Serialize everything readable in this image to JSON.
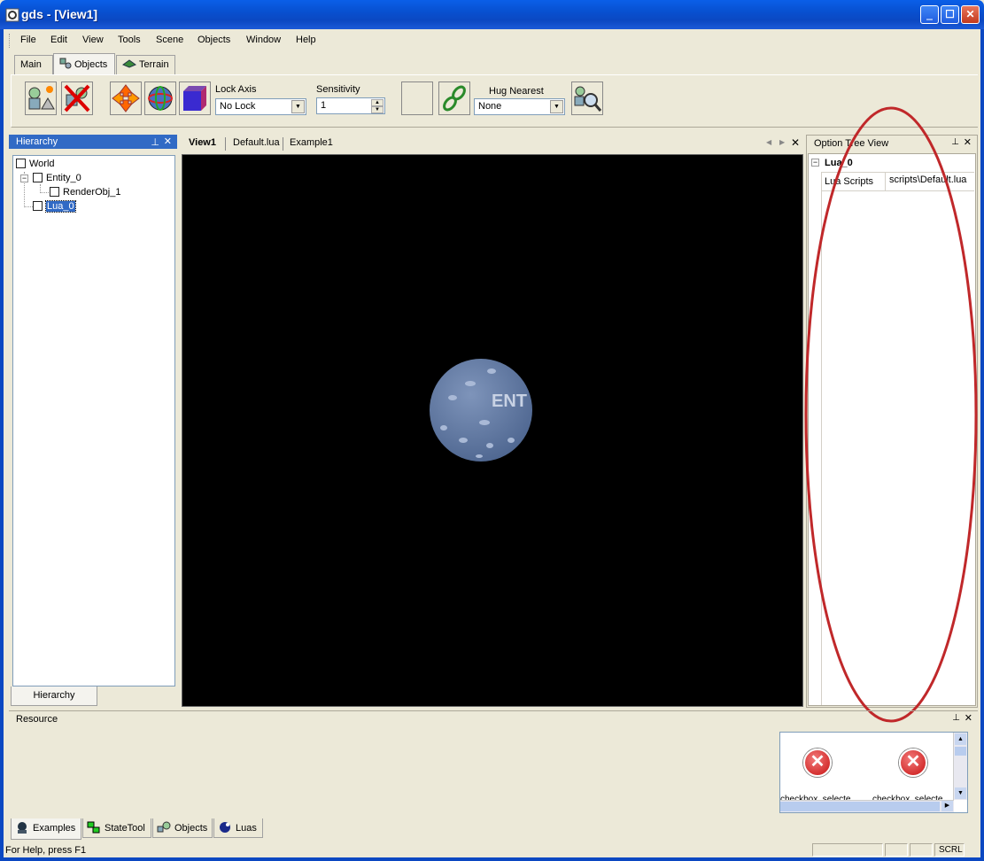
{
  "window": {
    "title": "gds - [View1]",
    "controls": {
      "minimize": "‗",
      "maximize": "☐",
      "close": "✕"
    }
  },
  "menu": [
    "File",
    "Edit",
    "View",
    "Tools",
    "Scene",
    "Objects",
    "Window",
    "Help"
  ],
  "toolbar_tabs": [
    "Main",
    "Objects",
    "Terrain"
  ],
  "toolbar": {
    "lock_axis_label": "Lock Axis",
    "lock_axis_value": "No Lock",
    "sensitivity_label": "Sensitivity",
    "sensitivity_value": "1",
    "hug_nearest_label": "Hug Nearest",
    "hug_nearest_value": "None"
  },
  "hierarchy": {
    "title": "Hierarchy",
    "nodes": [
      "World",
      "Entity_0",
      "RenderObj_1",
      "Lua_0"
    ],
    "bottom_tab": "Hierarchy"
  },
  "documents": {
    "tabs": [
      "View1",
      "Default.lua",
      "Example1"
    ]
  },
  "viewport": {
    "sphere_text": "ENT"
  },
  "option_tree": {
    "title": "Option Tree View",
    "node": "Lua_0",
    "property_name": "Lua Scripts",
    "property_value": "scripts\\Default.lua"
  },
  "resource": {
    "title": "Resource",
    "items": [
      "checkbox_selecte",
      "checkbox_selecte"
    ]
  },
  "bottom_tabs": [
    "Examples",
    "StateTool",
    "Objects",
    "Luas"
  ],
  "status": {
    "help_text": "For Help, press F1",
    "indicator": "SCRL"
  },
  "colors": {
    "titlebar": "#0b48c2",
    "selection": "#316ac5",
    "annotation": "#c0282a",
    "sphere": "#6a82a8"
  }
}
